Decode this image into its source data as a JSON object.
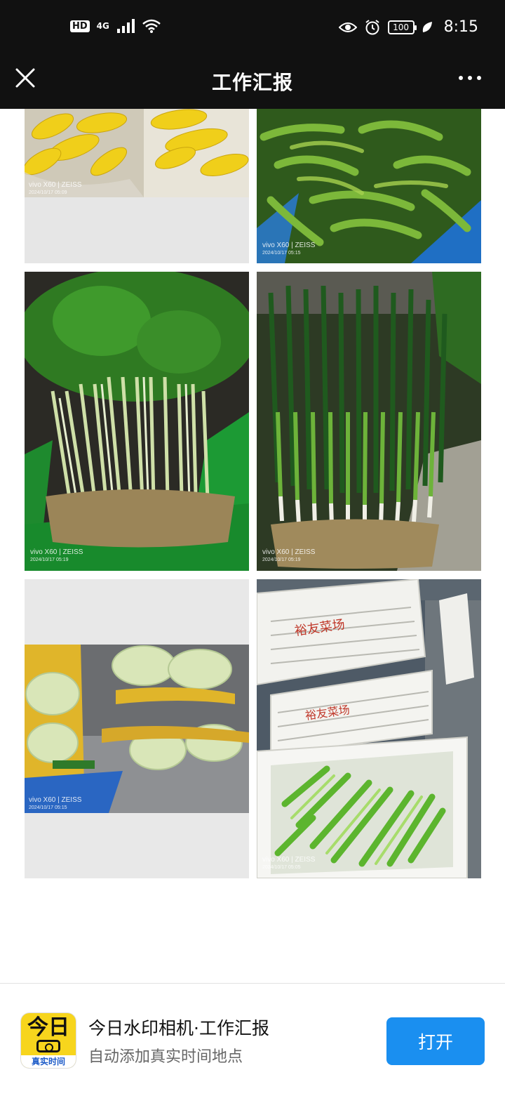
{
  "status_bar": {
    "hd": "HD",
    "network": "4G",
    "battery": "100",
    "time": "8:15",
    "icons": [
      "hd-icon",
      "signal-icon",
      "wifi-icon",
      "eye-icon",
      "alarm-icon",
      "battery-icon",
      "leaf-icon"
    ]
  },
  "nav": {
    "title": "工作汇报",
    "close_icon": "close-icon",
    "more_icon": "more-icon"
  },
  "photos": [
    {
      "subject": "corn",
      "wm_line1": "vivo X60 | ZEISS",
      "wm_line2": "2024/10/17 05:09"
    },
    {
      "subject": "green peppers",
      "wm_line1": "vivo X60 | ZEISS",
      "wm_line2": "2024/10/17 05:15"
    },
    {
      "subject": "celery",
      "wm_line1": "vivo X60 | ZEISS",
      "wm_line2": "2024/10/17 05:19"
    },
    {
      "subject": "scallions",
      "wm_line1": "vivo X60 | ZEISS",
      "wm_line2": "2024/10/17 05:19"
    },
    {
      "subject": "napa cabbage",
      "wm_line1": "vivo X60 | ZEISS",
      "wm_line2": "2024/10/17 05:15"
    },
    {
      "subject": "bok choy in crates",
      "wm_line1": "vivo X60 | ZEISS",
      "wm_line2": "2024/10/17 05:05",
      "crate_text": "裕友菜场"
    }
  ],
  "banner": {
    "app_icon_text": "今日",
    "app_icon_strip": "真实时间",
    "app_name": "今日水印相机·工作汇报",
    "app_subtitle": "自动添加真实时间地点",
    "open_button": "打开"
  },
  "colors": {
    "top_bar": "#111111",
    "open_button": "#1a8ff0",
    "app_icon_bg": "#f7d51d"
  }
}
